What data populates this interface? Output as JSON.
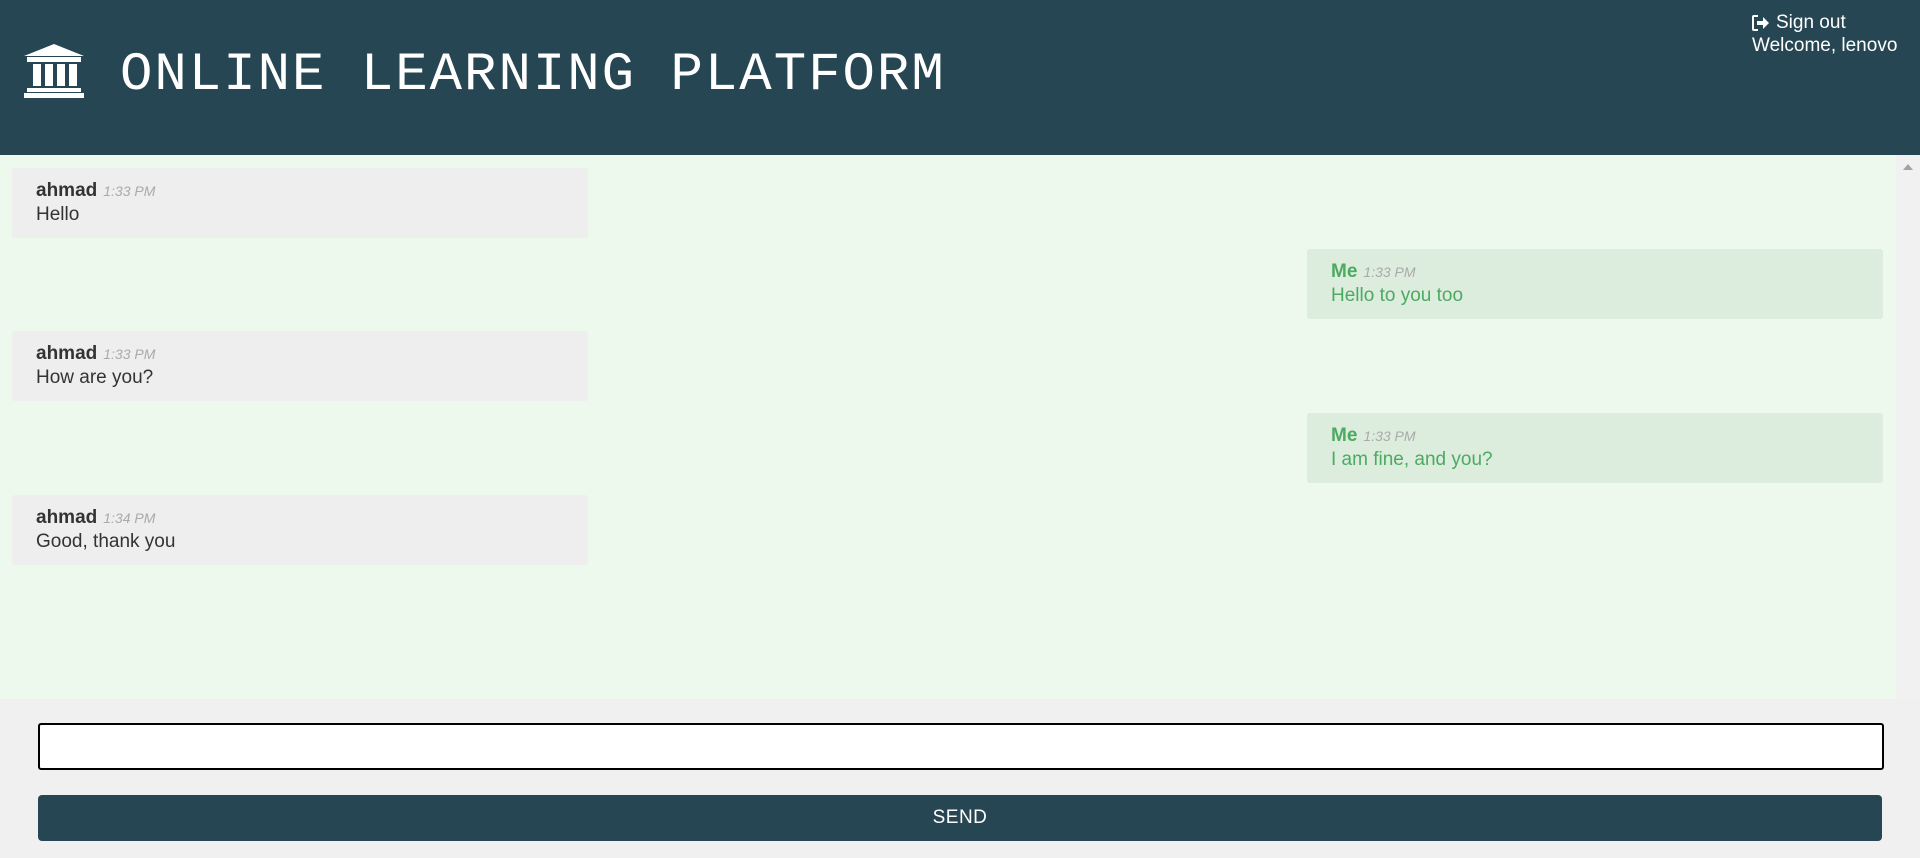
{
  "header": {
    "title": "ONLINE LEARNING PLATFORM",
    "logo_icon": "bank-columns-icon",
    "signout_label": "Sign out",
    "signout_icon": "sign-out-icon",
    "welcome_text": "Welcome, lenovo"
  },
  "messages": [
    {
      "author": "ahmad",
      "time": "1:33 PM",
      "text": "Hello",
      "direction": "incoming"
    },
    {
      "author": "Me",
      "time": "1:33 PM",
      "text": "Hello to you too",
      "direction": "outgoing"
    },
    {
      "author": "ahmad",
      "time": "1:33 PM",
      "text": "How are you?",
      "direction": "incoming"
    },
    {
      "author": "Me",
      "time": "1:33 PM",
      "text": "I am fine, and you?",
      "direction": "outgoing"
    },
    {
      "author": "ahmad",
      "time": "1:34 PM",
      "text": "Good, thank you",
      "direction": "incoming"
    }
  ],
  "composer": {
    "input_value": "",
    "send_label": "SEND"
  },
  "colors": {
    "header_bg": "#264653",
    "chat_bg": "#eef9ee",
    "incoming_bg": "#eeeeee",
    "outgoing_bg": "#dcecdd",
    "outgoing_text": "#4caa61"
  }
}
